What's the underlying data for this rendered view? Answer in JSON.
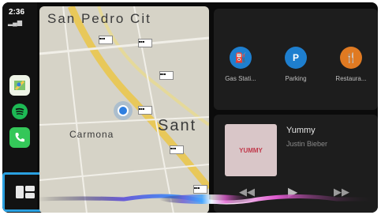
{
  "status": {
    "time": "2:36",
    "signal": "▂▄▆"
  },
  "map": {
    "labels": [
      "San Pedro Cit",
      "Carmona",
      "Sant"
    ],
    "road_badges": [
      "■■■",
      "■■■",
      "■■■",
      "■■■",
      "■■■",
      "■■■"
    ]
  },
  "shortcuts": [
    {
      "label": "Gas Stati...",
      "glyph": "⛽",
      "color": "#1e7fcf"
    },
    {
      "label": "Parking",
      "glyph": "P",
      "color": "#1e7fcf"
    },
    {
      "label": "Restaura...",
      "glyph": "🍴",
      "color": "#e07a22"
    }
  ],
  "now_playing": {
    "title": "Yummy",
    "artist": "Justin Bieber",
    "art_text": "YUMMY",
    "prev_glyph": "◀◀",
    "play_glyph": "▶",
    "next_glyph": "▶▶"
  },
  "apps": [
    {
      "name": "Maps",
      "color": "#4caf50"
    },
    {
      "name": "Spotify",
      "color": "#1db954"
    },
    {
      "name": "Phone",
      "color": "#34c759"
    }
  ],
  "colors": {
    "highlight": "#2aa0e0",
    "route": "#e8c85a",
    "location": "#2f7fe0"
  }
}
